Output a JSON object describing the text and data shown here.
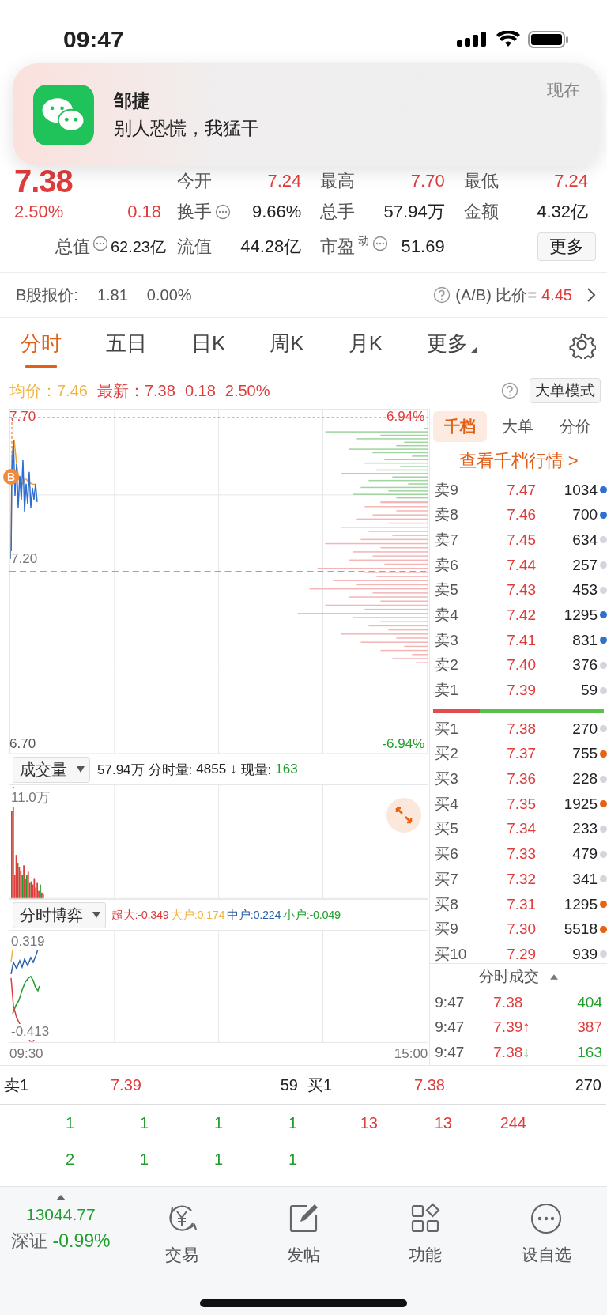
{
  "status_bar": {
    "time": "09:47"
  },
  "notification": {
    "title": "邹捷",
    "message": "别人恐慌，我猛干",
    "time": "现在"
  },
  "quote": {
    "price": "7.38",
    "change_pct": "2.50%",
    "change": "0.18",
    "total_value": {
      "label": "总值",
      "value": "62.23亿"
    },
    "more_button": "更多",
    "stats": [
      {
        "label": "今开",
        "value": "7.24",
        "rising": true
      },
      {
        "label": "最高",
        "value": "7.70",
        "rising": true
      },
      {
        "label": "最低",
        "value": "7.24",
        "rising": true
      },
      {
        "label": "换手",
        "value": "9.66%",
        "rising": false,
        "info": true
      },
      {
        "label": "总手",
        "value": "57.94万",
        "rising": false
      },
      {
        "label": "金额",
        "value": "4.32亿",
        "rising": false
      },
      {
        "label": "流值",
        "value": "44.28亿",
        "rising": false
      },
      {
        "label": "市盈",
        "sup": "动",
        "value": "51.69",
        "rising": false,
        "info": true
      }
    ]
  },
  "b_share": {
    "label": "B股报价:",
    "price": "1.81",
    "change": "0.00%",
    "ratio_label": "(A/B) 比价=",
    "ratio": "4.45"
  },
  "tabs": [
    {
      "label": "分时",
      "selected": true,
      "kind": "tab"
    },
    {
      "label": "五日",
      "selected": false,
      "kind": "tab"
    },
    {
      "label": "日K",
      "selected": false,
      "kind": "tab"
    },
    {
      "label": "周K",
      "selected": false,
      "kind": "tab"
    },
    {
      "label": "月K",
      "selected": false,
      "kind": "tab"
    },
    {
      "label": "更多",
      "selected": false,
      "kind": "menu"
    }
  ],
  "summary": {
    "avg_label": "均价：",
    "avg": "7.46",
    "latest_label": "最新：",
    "latest": "7.38",
    "change": "0.18",
    "change_pct": "2.50%",
    "mode_button": "大单模式"
  },
  "price_chart": {
    "top_price": "7.70",
    "top_pct": "6.94%",
    "mid_price": "7.20",
    "bottom_price": "6.70",
    "bottom_pct": "-6.94%",
    "marker": "B"
  },
  "volume": {
    "selector": "成交量",
    "total": "57.94万",
    "interval_label": "分时量:",
    "interval": "4855",
    "arrow": "↓",
    "current_label": "现量:",
    "current": "163",
    "axis_max": "11.0万"
  },
  "game": {
    "selector": "分时博弈",
    "y_max": "0.319",
    "y_min": "-0.413",
    "series": [
      {
        "label": "超大:",
        "value": "-0.349",
        "color": "#e03c3c"
      },
      {
        "label": "大户:",
        "value": "0.174",
        "color": "#f2b640"
      },
      {
        "label": "中户:",
        "value": "0.224",
        "color": "#2b5fa8"
      },
      {
        "label": "小户:",
        "value": "-0.049",
        "color": "#1f9e2c"
      }
    ]
  },
  "time_axis": {
    "start": "09:30",
    "end": "15:00"
  },
  "book": {
    "tabs": [
      {
        "label": "千档",
        "selected": true
      },
      {
        "label": "大单",
        "selected": false
      },
      {
        "label": "分价",
        "selected": false
      }
    ],
    "link": "查看千档行情 >",
    "level": 0.27,
    "asks": [
      {
        "label": "卖9",
        "price": "7.47",
        "volume": "1034",
        "color": "#2f6fd1"
      },
      {
        "label": "卖8",
        "price": "7.46",
        "volume": "700",
        "color": "#2f6fd1"
      },
      {
        "label": "卖7",
        "price": "7.45",
        "volume": "634",
        "color": "#d3d6dc"
      },
      {
        "label": "卖6",
        "price": "7.44",
        "volume": "257",
        "color": "#d3d6dc"
      },
      {
        "label": "卖5",
        "price": "7.43",
        "volume": "453",
        "color": "#d3d6dc"
      },
      {
        "label": "卖4",
        "price": "7.42",
        "volume": "1295",
        "color": "#2f6fd1"
      },
      {
        "label": "卖3",
        "price": "7.41",
        "volume": "831",
        "color": "#2f6fd1"
      },
      {
        "label": "卖2",
        "price": "7.40",
        "volume": "376",
        "color": "#d3d6dc"
      },
      {
        "label": "卖1",
        "price": "7.39",
        "volume": "59",
        "color": "#d3d6dc"
      }
    ],
    "bids": [
      {
        "label": "买1",
        "price": "7.38",
        "volume": "270",
        "color": "#d3d6dc"
      },
      {
        "label": "买2",
        "price": "7.37",
        "volume": "755",
        "color": "#e8620f"
      },
      {
        "label": "买3",
        "price": "7.36",
        "volume": "228",
        "color": "#d3d6dc"
      },
      {
        "label": "买4",
        "price": "7.35",
        "volume": "1925",
        "color": "#e8620f"
      },
      {
        "label": "买5",
        "price": "7.34",
        "volume": "233",
        "color": "#d3d6dc"
      },
      {
        "label": "买6",
        "price": "7.33",
        "volume": "479",
        "color": "#d3d6dc"
      },
      {
        "label": "买7",
        "price": "7.32",
        "volume": "341",
        "color": "#d3d6dc"
      },
      {
        "label": "买8",
        "price": "7.31",
        "volume": "1295",
        "color": "#e8620f"
      },
      {
        "label": "买9",
        "price": "7.30",
        "volume": "5518",
        "color": "#e8620f"
      },
      {
        "label": "买10",
        "price": "7.29",
        "volume": "939",
        "color": "#d3d6dc"
      }
    ]
  },
  "ticks": {
    "title": "分时成交",
    "rows": [
      {
        "time": "9:47",
        "price": "7.38",
        "buy": false,
        "volume": "404"
      },
      {
        "time": "9:47",
        "price": "7.39",
        "arrow": "↑",
        "buy": true,
        "volume": "387"
      },
      {
        "time": "9:47",
        "price": "7.38",
        "arrow": "↓",
        "buy": false,
        "volume": "163"
      }
    ]
  },
  "level1": {
    "ask": {
      "label": "卖1",
      "price": "7.39",
      "volume": "59",
      "queue": [
        [
          "1",
          "1",
          "1",
          "1"
        ],
        [
          "2",
          "1",
          "1",
          "1"
        ]
      ]
    },
    "bid": {
      "label": "买1",
      "price": "7.38",
      "volume": "270",
      "queue": [
        [
          "13",
          "13",
          "244"
        ]
      ]
    }
  },
  "bottom_nav": {
    "index": {
      "value": "13044.77",
      "name": "深证",
      "change": "-0.99%"
    },
    "items": [
      {
        "label": "交易",
        "kind": "trade"
      },
      {
        "label": "发帖",
        "kind": "post"
      },
      {
        "label": "功能",
        "kind": "apps"
      },
      {
        "label": "设自选",
        "kind": "more"
      }
    ]
  }
}
